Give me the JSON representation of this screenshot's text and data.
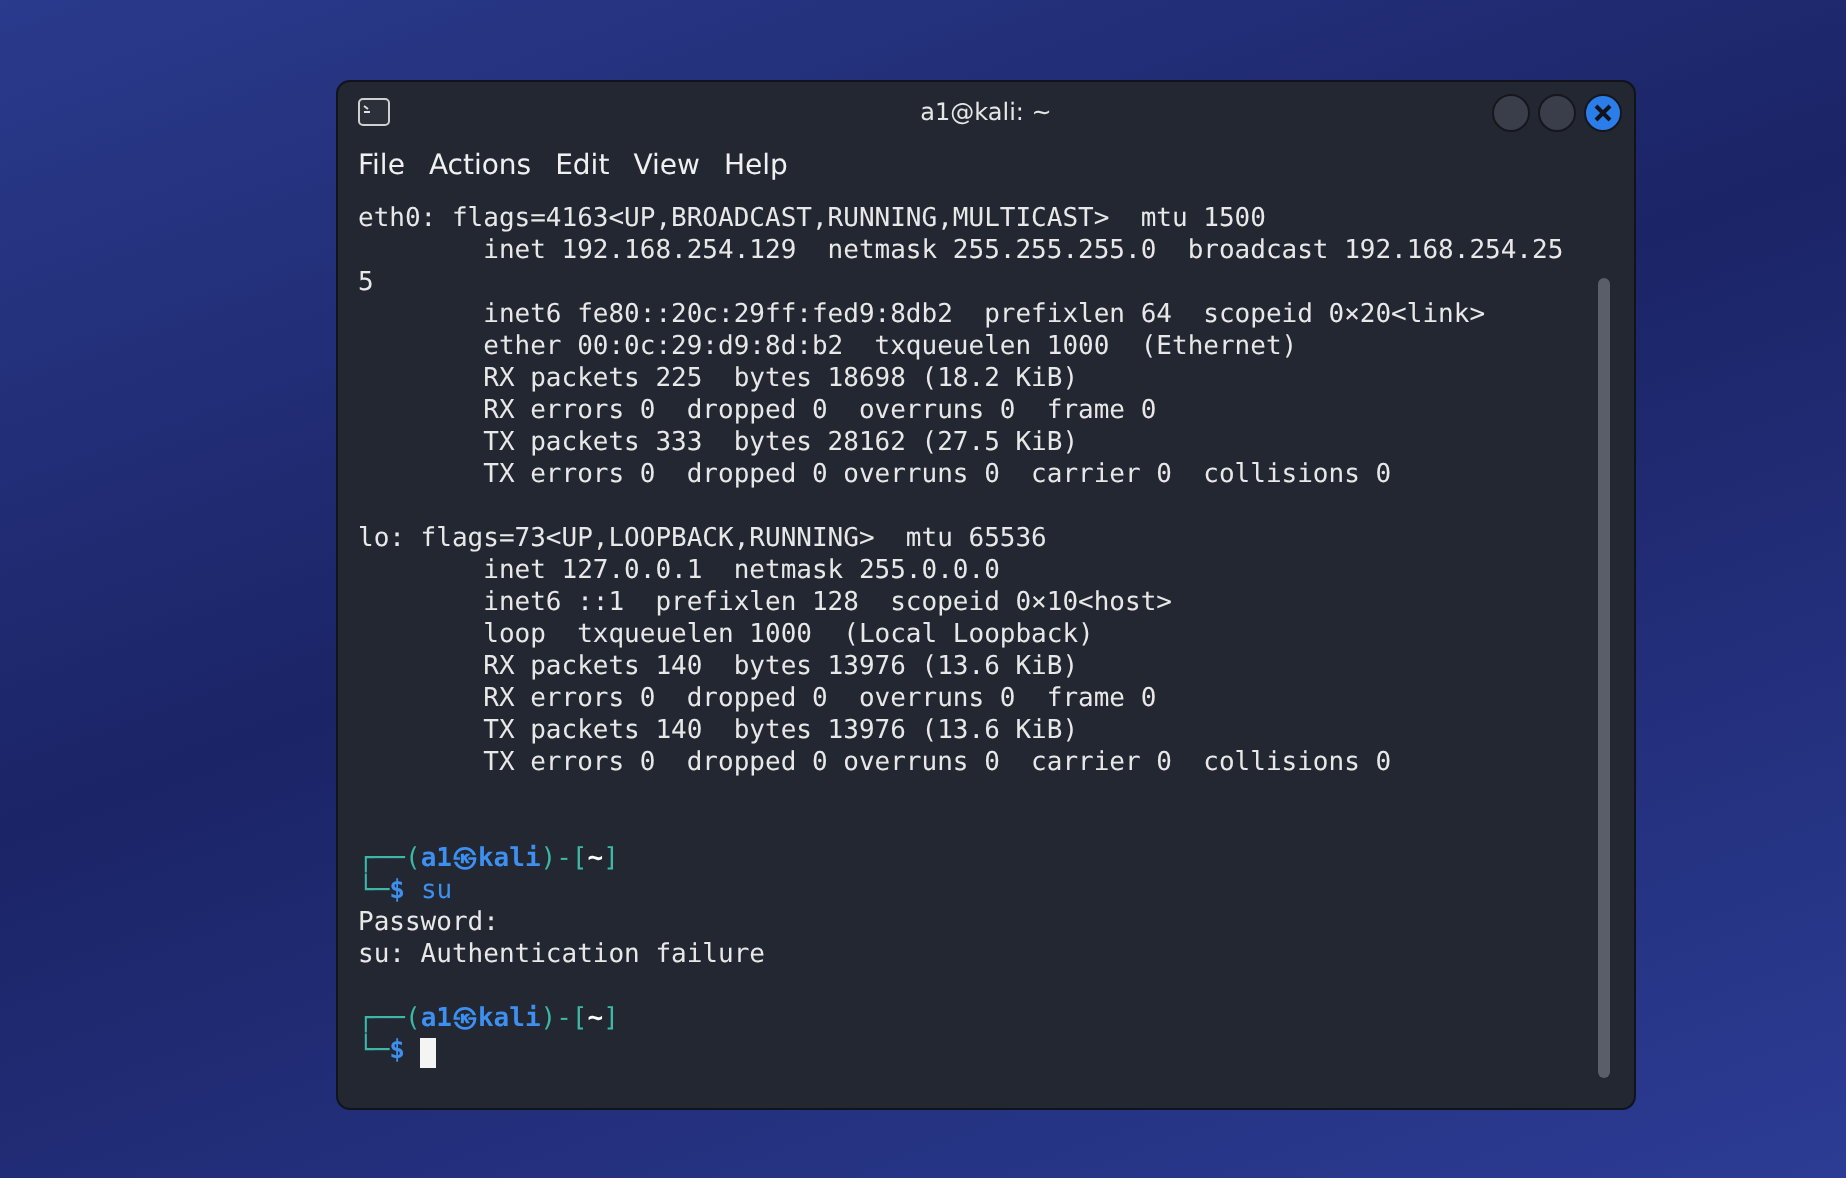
{
  "window": {
    "title": "a1@kali: ~"
  },
  "menu": [
    "File",
    "Actions",
    "Edit",
    "View",
    "Help"
  ],
  "terminal": {
    "lines": [
      {
        "kind": "output",
        "text": "eth0: flags=4163<UP,BROADCAST,RUNNING,MULTICAST>  mtu 1500"
      },
      {
        "kind": "output",
        "text": "        inet 192.168.254.129  netmask 255.255.255.0  broadcast 192.168.254.25"
      },
      {
        "kind": "output",
        "text": "5"
      },
      {
        "kind": "output",
        "text": "        inet6 fe80::20c:29ff:fed9:8db2  prefixlen 64  scopeid 0×20<link>"
      },
      {
        "kind": "output",
        "text": "        ether 00:0c:29:d9:8d:b2  txqueuelen 1000  (Ethernet)"
      },
      {
        "kind": "output",
        "text": "        RX packets 225  bytes 18698 (18.2 KiB)"
      },
      {
        "kind": "output",
        "text": "        RX errors 0  dropped 0  overruns 0  frame 0"
      },
      {
        "kind": "output",
        "text": "        TX packets 333  bytes 28162 (27.5 KiB)"
      },
      {
        "kind": "output",
        "text": "        TX errors 0  dropped 0 overruns 0  carrier 0  collisions 0"
      },
      {
        "kind": "blank"
      },
      {
        "kind": "output",
        "text": "lo: flags=73<UP,LOOPBACK,RUNNING>  mtu 65536"
      },
      {
        "kind": "output",
        "text": "        inet 127.0.0.1  netmask 255.0.0.0"
      },
      {
        "kind": "output",
        "text": "        inet6 ::1  prefixlen 128  scopeid 0×10<host>"
      },
      {
        "kind": "output",
        "text": "        loop  txqueuelen 1000  (Local Loopback)"
      },
      {
        "kind": "output",
        "text": "        RX packets 140  bytes 13976 (13.6 KiB)"
      },
      {
        "kind": "output",
        "text": "        RX errors 0  dropped 0  overruns 0  frame 0"
      },
      {
        "kind": "output",
        "text": "        TX packets 140  bytes 13976 (13.6 KiB)"
      },
      {
        "kind": "output",
        "text": "        TX errors 0  dropped 0 overruns 0  carrier 0  collisions 0"
      },
      {
        "kind": "blank"
      },
      {
        "kind": "blank"
      },
      {
        "kind": "prompt_header",
        "open": "┌──(",
        "identity": "a1㉿kali",
        "middle": ")-[",
        "cwd": "~",
        "close": "]"
      },
      {
        "kind": "prompt_input",
        "corner": "└─",
        "sign": "$",
        "command": "su"
      },
      {
        "kind": "output",
        "text": "Password:"
      },
      {
        "kind": "output",
        "text": "su: Authentication failure"
      },
      {
        "kind": "blank"
      },
      {
        "kind": "prompt_header",
        "open": "┌──(",
        "identity": "a1㉿kali",
        "middle": ")-[",
        "cwd": "~",
        "close": "]"
      },
      {
        "kind": "prompt_input",
        "corner": "└─",
        "sign": "$",
        "cursor": true
      }
    ]
  }
}
